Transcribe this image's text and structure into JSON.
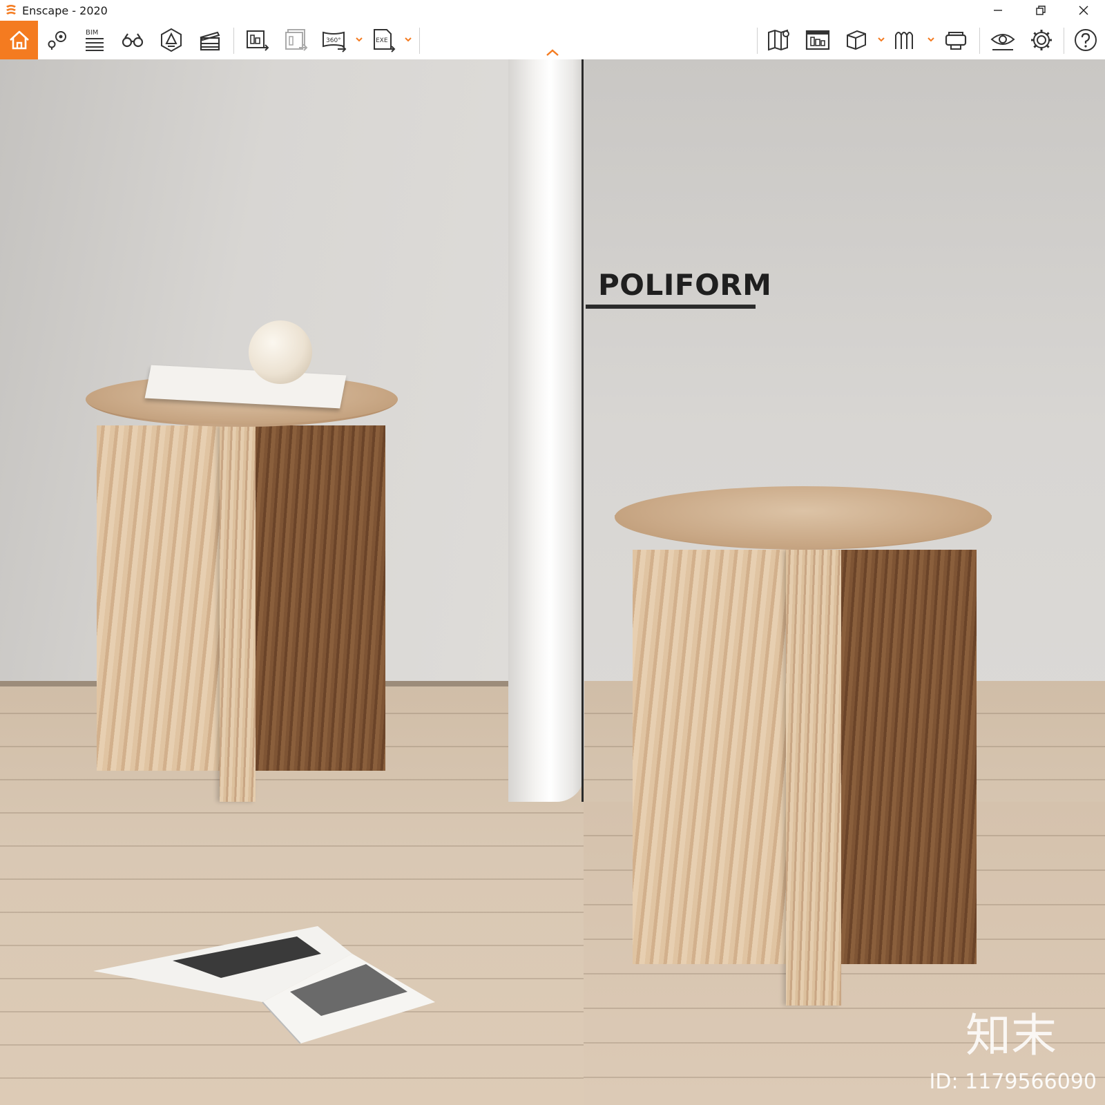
{
  "window": {
    "title": "Enscape - 2020",
    "logo_icon": "enscape-logo-icon",
    "controls": [
      "minimize-icon",
      "restore-icon",
      "close-icon"
    ]
  },
  "toolbar": {
    "accent_color": "#f47b20",
    "bim_label": "BIM",
    "panorama_badge": "360°",
    "exe_badge": "EXE",
    "left_buttons": [
      "home-icon",
      "views-pin-icon",
      "bim-icon",
      "binoculars-icon",
      "atmosphere-icon",
      "video-editor-icon",
      "screenshot-export-icon",
      "batch-render-icon",
      "panorama-360-icon",
      "exe-export-icon"
    ],
    "right_buttons": [
      "minimap-icon",
      "asset-library-icon",
      "cube-view-icon",
      "section-icon",
      "vr-headset-icon",
      "visual-settings-icon",
      "gear-icon",
      "help-icon"
    ]
  },
  "scene": {
    "brand_sign": "POLIFORM",
    "watermark_logo": "知末",
    "watermark_id": "ID: 1179566090"
  }
}
